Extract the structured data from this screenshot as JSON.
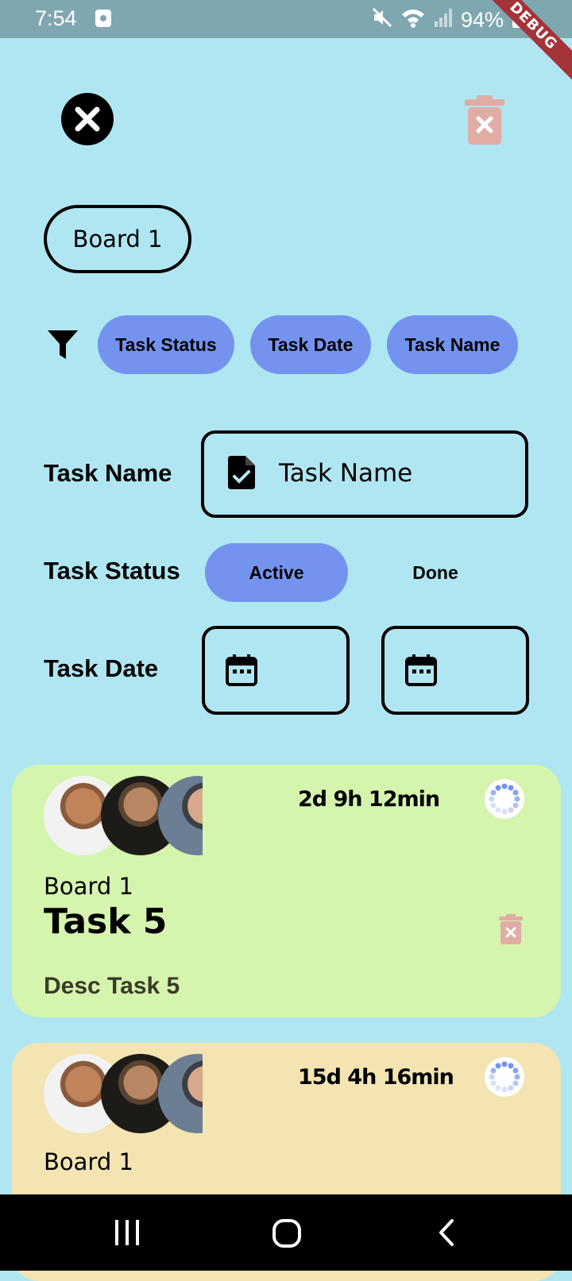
{
  "status_bar": {
    "time": "7:54",
    "battery": "94%",
    "debug_banner": "DEBUG"
  },
  "header": {
    "close_icon": "close-icon",
    "delete_icon": "trash-icon"
  },
  "board_chip": {
    "label": "Board 1"
  },
  "filters": {
    "icon": "filter-icon",
    "chips": [
      {
        "label": "Task Status"
      },
      {
        "label": "Task Date"
      },
      {
        "label": "Task Name"
      }
    ]
  },
  "form": {
    "name_label": "Task Name",
    "name_placeholder": "Task Name",
    "status_label": "Task Status",
    "status_options": [
      {
        "label": "Active",
        "selected": true
      },
      {
        "label": "Done",
        "selected": false
      }
    ],
    "date_label": "Task Date"
  },
  "cards": [
    {
      "timer": "2d 9h 12min",
      "board": "Board 1",
      "title": "Task 5",
      "description": "Desc Task 5"
    },
    {
      "timer": "15d 4h 16min",
      "board": "Board 1"
    }
  ],
  "colors": {
    "background": "#b0e6f2",
    "accent": "#7393ef",
    "card_1": "#d5f4ad",
    "card_2": "#f3e4b1",
    "trash": "#e0aca4"
  }
}
